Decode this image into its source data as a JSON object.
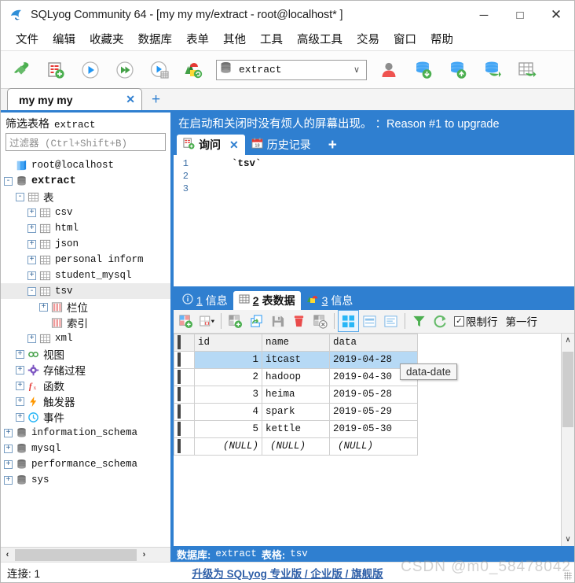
{
  "window": {
    "title": "SQLyog Community 64 - [my my my/extract - root@localhost* ]",
    "logo_icon": "sqlyog-dolphin-icon",
    "minimize_label": "─",
    "maximize_label": "□",
    "close_label": "✕"
  },
  "menubar": {
    "items": [
      {
        "label": "文件",
        "name": "menu-file"
      },
      {
        "label": "编辑",
        "name": "menu-edit"
      },
      {
        "label": "收藏夹",
        "name": "menu-favorites"
      },
      {
        "label": "数据库",
        "name": "menu-database"
      },
      {
        "label": "表单",
        "name": "menu-form"
      },
      {
        "label": "其他",
        "name": "menu-other"
      },
      {
        "label": "工具",
        "name": "menu-tools"
      },
      {
        "label": "高级工具",
        "name": "menu-advanced-tools"
      },
      {
        "label": "交易",
        "name": "menu-transaction"
      },
      {
        "label": "窗口",
        "name": "menu-window"
      },
      {
        "label": "帮助",
        "name": "menu-help"
      }
    ]
  },
  "toolbar": {
    "buttons": [
      {
        "name": "new-connection-icon"
      },
      {
        "name": "new-query-tab-icon"
      },
      {
        "name": "execute-query-icon"
      },
      {
        "name": "execute-all-queries-icon"
      },
      {
        "name": "execute-query-to-grid-icon"
      },
      {
        "name": "schema-designer-icon"
      }
    ],
    "database_select": {
      "value": "extract",
      "icon": "database-icon",
      "chevron": "∨"
    },
    "right_buttons": [
      {
        "name": "user-manager-icon"
      },
      {
        "name": "import-database-icon"
      },
      {
        "name": "export-database-icon"
      },
      {
        "name": "backup-database-icon"
      },
      {
        "name": "export-table-data-icon"
      }
    ]
  },
  "connection_tabs": {
    "tabs": [
      {
        "label": "my my my",
        "close": "✕"
      }
    ],
    "add_label": "+"
  },
  "sidebar": {
    "filter_title_label": "筛选表格",
    "filter_title_value": "extract",
    "filter_placeholder": "过滤器 (Ctrl+Shift+B)",
    "tree": [
      {
        "indent": 0,
        "toggle": "",
        "icon": "host-icon",
        "label": "root@localhost",
        "mono": true,
        "bold": false,
        "selected": false
      },
      {
        "indent": 0,
        "toggle": "-",
        "icon": "database-icon",
        "label": "extract",
        "mono": true,
        "bold": true,
        "selected": false
      },
      {
        "indent": 1,
        "toggle": "-",
        "icon": "table-icon",
        "label": "表",
        "mono": false,
        "bold": false,
        "selected": false
      },
      {
        "indent": 2,
        "toggle": "+",
        "icon": "table-icon",
        "label": "csv",
        "mono": true,
        "bold": false,
        "selected": false
      },
      {
        "indent": 2,
        "toggle": "+",
        "icon": "table-icon",
        "label": "html",
        "mono": true,
        "bold": false,
        "selected": false
      },
      {
        "indent": 2,
        "toggle": "+",
        "icon": "table-icon",
        "label": "json",
        "mono": true,
        "bold": false,
        "selected": false
      },
      {
        "indent": 2,
        "toggle": "+",
        "icon": "table-icon",
        "label": "personal inform",
        "mono": true,
        "bold": false,
        "selected": false
      },
      {
        "indent": 2,
        "toggle": "+",
        "icon": "table-icon",
        "label": "student_mysql",
        "mono": true,
        "bold": false,
        "selected": false
      },
      {
        "indent": 2,
        "toggle": "-",
        "icon": "table-icon",
        "label": "tsv",
        "mono": true,
        "bold": false,
        "selected": true
      },
      {
        "indent": 3,
        "toggle": "+",
        "icon": "columns-icon",
        "label": "栏位",
        "mono": false,
        "bold": false,
        "selected": false
      },
      {
        "indent": 3,
        "toggle": "",
        "icon": "index-icon",
        "label": "索引",
        "mono": false,
        "bold": false,
        "selected": false
      },
      {
        "indent": 2,
        "toggle": "+",
        "icon": "table-icon",
        "label": "xml",
        "mono": true,
        "bold": false,
        "selected": false
      },
      {
        "indent": 1,
        "toggle": "+",
        "icon": "view-icon",
        "label": "视图",
        "mono": false,
        "bold": false,
        "selected": false
      },
      {
        "indent": 1,
        "toggle": "+",
        "icon": "procedure-icon",
        "label": "存储过程",
        "mono": false,
        "bold": false,
        "selected": false
      },
      {
        "indent": 1,
        "toggle": "+",
        "icon": "function-icon",
        "label": "函数",
        "mono": false,
        "bold": false,
        "selected": false
      },
      {
        "indent": 1,
        "toggle": "+",
        "icon": "trigger-icon",
        "label": "触发器",
        "mono": false,
        "bold": false,
        "selected": false
      },
      {
        "indent": 1,
        "toggle": "+",
        "icon": "event-icon",
        "label": "事件",
        "mono": false,
        "bold": false,
        "selected": false
      },
      {
        "indent": 0,
        "toggle": "+",
        "icon": "database-icon",
        "label": "information_schema",
        "mono": true,
        "bold": false,
        "selected": false
      },
      {
        "indent": 0,
        "toggle": "+",
        "icon": "database-icon",
        "label": "mysql",
        "mono": true,
        "bold": false,
        "selected": false
      },
      {
        "indent": 0,
        "toggle": "+",
        "icon": "database-icon",
        "label": "performance_schema",
        "mono": true,
        "bold": false,
        "selected": false
      },
      {
        "indent": 0,
        "toggle": "+",
        "icon": "database-icon",
        "label": "sys",
        "mono": true,
        "bold": false,
        "selected": false
      }
    ],
    "hscroll_left": "‹",
    "hscroll_right": "›"
  },
  "promo": {
    "text": "在启动和关闭时没有烦人的屏幕出现。 ：Reason #1 to upgrade"
  },
  "query_tabs": {
    "tabs": [
      {
        "label": "询问",
        "icon": "query-icon",
        "active": true,
        "close": "✕"
      },
      {
        "label": "历史记录",
        "icon": "history-calendar-icon",
        "active": false,
        "close": ""
      }
    ],
    "add_label": "+"
  },
  "editor": {
    "line_numbers": [
      "1",
      "2",
      "3"
    ],
    "lines": [
      "    `tsv`",
      "",
      ""
    ]
  },
  "result_tabs": {
    "tabs": [
      {
        "num": "1",
        "label": "信息",
        "icon": "info-icon",
        "active": false
      },
      {
        "num": "2",
        "label": "表数据",
        "icon": "table-grid-icon",
        "active": true
      },
      {
        "num": "3",
        "label": "信息",
        "icon": "objects-icon",
        "active": false
      }
    ]
  },
  "result_toolbar": {
    "buttons": [
      {
        "name": "insert-row-icon"
      },
      {
        "name": "insert-blank-row-dropdown-icon"
      },
      {
        "name": "duplicate-row-icon"
      },
      {
        "name": "update-row-icon"
      },
      {
        "name": "save-changes-icon"
      },
      {
        "name": "delete-row-icon"
      },
      {
        "name": "delete-all-rows-icon"
      },
      {
        "name": "grid-view-icon"
      },
      {
        "name": "form-view-icon"
      },
      {
        "name": "text-view-icon"
      },
      {
        "name": "filter-icon"
      },
      {
        "name": "refresh-icon"
      }
    ],
    "limit_rows_label": "限制行",
    "limit_rows_checked": "✓",
    "first_row_label": "第一行"
  },
  "grid": {
    "columns": [
      "id",
      "name",
      "data"
    ],
    "selected_column": "id",
    "rows": [
      {
        "id": "1",
        "name": "itcast",
        "data": "2019-04-28",
        "selected": true
      },
      {
        "id": "2",
        "name": "hadoop",
        "data": "2019-04-30",
        "selected": false
      },
      {
        "id": "3",
        "name": "heima",
        "data": "2019-05-28",
        "selected": false
      },
      {
        "id": "4",
        "name": "spark",
        "data": "2019-05-29",
        "selected": false
      },
      {
        "id": "5",
        "name": "kettle",
        "data": "2019-05-30",
        "selected": false
      },
      {
        "id": "(NULL)",
        "name": "(NULL)",
        "data": "(NULL)",
        "selected": false,
        "is_null": true
      }
    ],
    "tooltip": "data-date",
    "scroll_up": "∧",
    "scroll_down": "∨"
  },
  "grid_status": {
    "db_label": "数据库:",
    "db_value": "extract",
    "table_label": "表格:",
    "table_value": "tsv"
  },
  "statusbar": {
    "connection": "连接: 1",
    "upgrade_link": "升级为 SQLyog 专业版 / 企业版 / 旗舰版",
    "watermark": "CSDN @m0_58478042"
  },
  "colors": {
    "accent": "#2f7fd0",
    "selection": "#b6d9f5",
    "header_selected": "#6bb3ec",
    "link": "#2f5fa8"
  }
}
